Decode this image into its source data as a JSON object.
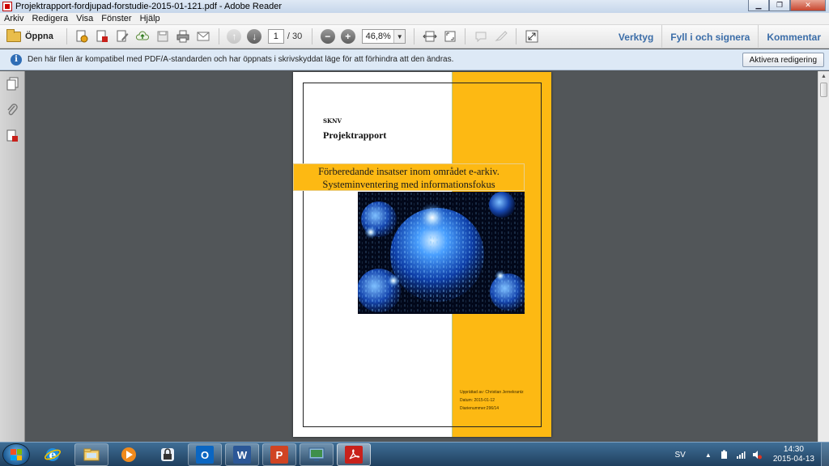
{
  "window": {
    "title": "Projektrapport-fordjupad-forstudie-2015-01-121.pdf - Adobe Reader",
    "buttons": [
      "minimize",
      "maximize",
      "close"
    ]
  },
  "menubar": {
    "items": [
      "Arkiv",
      "Redigera",
      "Visa",
      "Fönster",
      "Hjälp"
    ]
  },
  "toolbar": {
    "open_label": "Öppna",
    "current_page": "1",
    "total_pages": "/ 30",
    "zoom": "46,8%",
    "right_links": [
      "Verktyg",
      "Fyll i och signera",
      "Kommentar"
    ]
  },
  "infobar": {
    "message": "Den här filen är kompatibel med PDF/A-standarden och har öppnats i skrivskyddat läge för att förhindra att den ändras.",
    "button": "Aktivera redigering"
  },
  "document": {
    "org": "SKNV",
    "doctype": "Projektrapport",
    "title_line1": "Förberedande insatser inom området e-arkiv.",
    "title_line2": "Systeminventering med informationsfokus",
    "author": "Upprättad av: Christian Jernekrantz",
    "date": "Datum: 2015-01-12",
    "diarie": "Diarienummer:296/14",
    "colors": {
      "accent": "#fdb913",
      "image_blue": "#1e6fe0"
    }
  },
  "taskbar": {
    "apps": [
      "start-button",
      "internet-explorer",
      "file-explorer",
      "media-player",
      "keepass",
      "outlook",
      "word",
      "powerpoint",
      "remote-desktop",
      "adobe-reader"
    ],
    "language": "SV",
    "time": "14:30",
    "date": "2015-04-13"
  }
}
